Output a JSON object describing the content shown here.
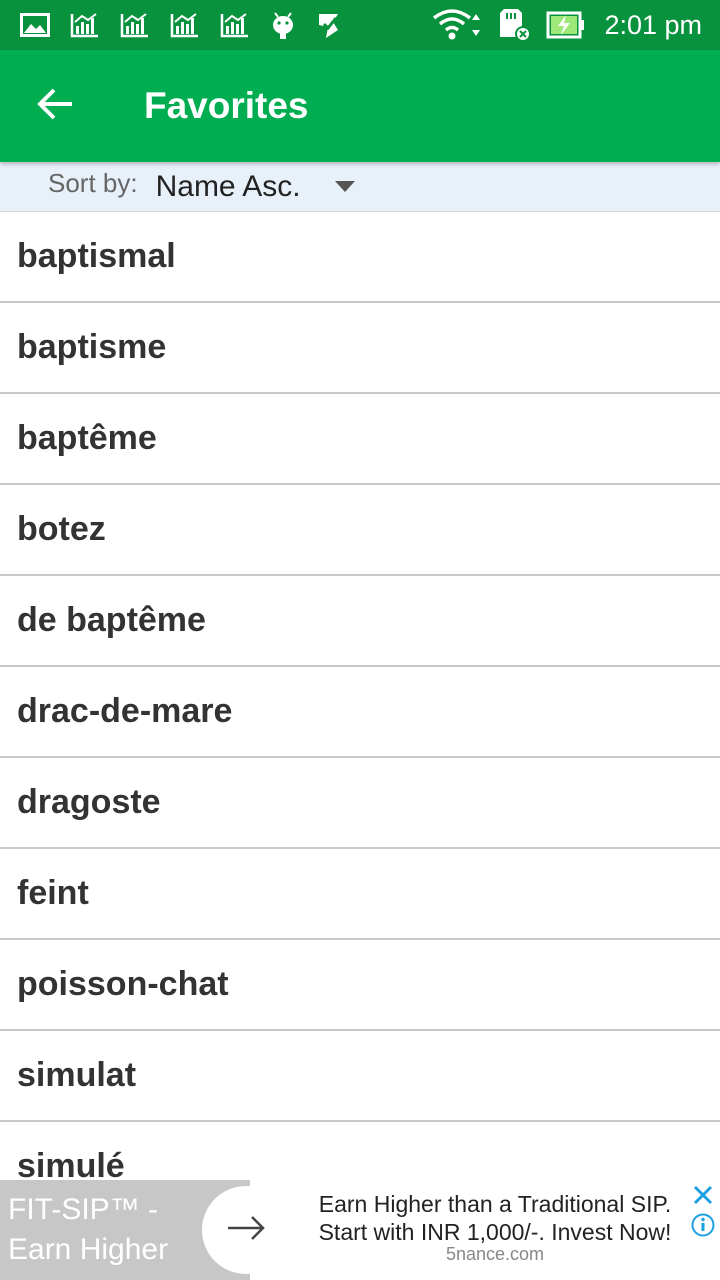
{
  "status_bar": {
    "time": "2:01 pm",
    "icons": [
      "image-icon",
      "chart-icon",
      "chart-icon",
      "chart-icon",
      "chart-icon",
      "android-icon",
      "check-icon",
      "wifi-icon",
      "sd-card-icon",
      "battery-charging-icon"
    ]
  },
  "app_bar": {
    "title": "Favorites",
    "back_icon": "arrow-back-icon"
  },
  "sort": {
    "label": "Sort by:",
    "value": "Name Asc."
  },
  "words": [
    {
      "text": "baptismal"
    },
    {
      "text": "baptisme"
    },
    {
      "text": "baptême"
    },
    {
      "text": "botez"
    },
    {
      "text": "de baptême"
    },
    {
      "text": "drac-de-mare"
    },
    {
      "text": "dragoste"
    },
    {
      "text": "feint"
    },
    {
      "text": "poisson-chat"
    },
    {
      "text": "simulat"
    },
    {
      "text": "simulé"
    }
  ],
  "ad": {
    "headline_line1": "FIT-SIP™ -",
    "headline_line2": "Earn Higher",
    "body_line1": "Earn Higher than a Traditional SIP.",
    "body_line2": "Start with INR 1,000/-. Invest Now!",
    "domain": "5nance.com"
  },
  "colors": {
    "status_bar": "#08923d",
    "app_bar": "#00ad50",
    "sort_bar": "#e8f0f9",
    "ad_accent": "#1ba0e1"
  }
}
